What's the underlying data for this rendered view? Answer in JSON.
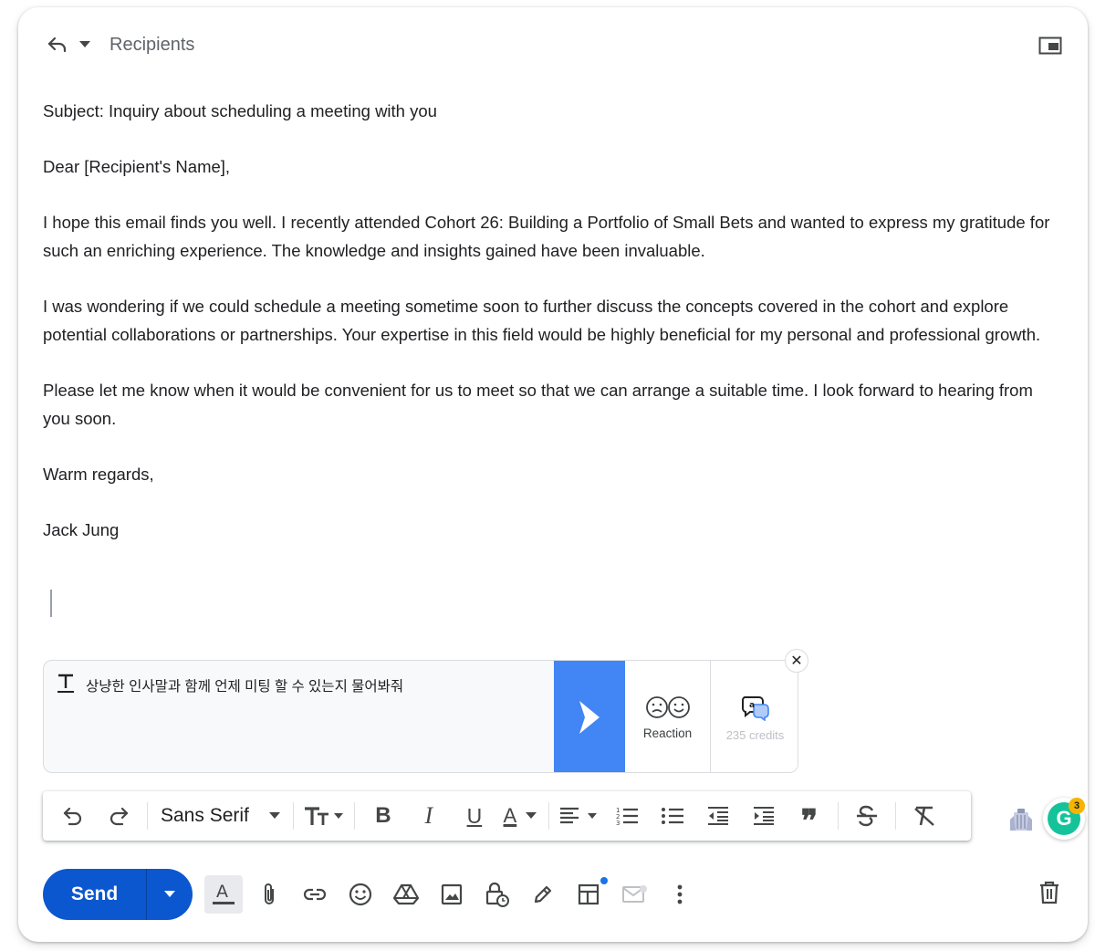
{
  "header": {
    "recipients_placeholder": "Recipients"
  },
  "email": {
    "subject_line": "Subject: Inquiry about scheduling a meeting with you",
    "greeting": "Dear [Recipient's Name],",
    "paragraph_1": "I hope this email finds you well. I recently attended Cohort 26: Building a Portfolio of Small Bets and wanted to express my gratitude for such an enriching experience. The knowledge and insights gained have been invaluable.",
    "paragraph_2": "I was wondering if we could schedule a meeting sometime soon to further discuss the concepts covered in the cohort and explore potential collaborations or partnerships. Your expertise in this field would be highly beneficial for my personal and professional growth.",
    "paragraph_3": "Please let me know when it would be convenient for us to meet so that we can arrange a suitable time. I look forward to hearing from you soon.",
    "closing": "Warm regards,",
    "signature": "Jack Jung"
  },
  "ai_panel": {
    "prompt": "상냥한 인사말과 함께 언제 미팅 할 수 있는지 물어봐줘",
    "reaction_label": "Reaction",
    "credits_label": "235 credits",
    "close_glyph": "✕",
    "accent_color": "#4285f4"
  },
  "format_toolbar": {
    "font_name": "Sans Serif",
    "bold_glyph": "B",
    "italic_glyph": "I",
    "underline_glyph": "U",
    "text_color_glyph": "A",
    "quote_glyph": "❞"
  },
  "grammarly": {
    "letter": "G",
    "badge_count": "3",
    "color": "#15c39a"
  },
  "bottom_bar": {
    "send_label": "Send",
    "send_color": "#0b57d0",
    "text_format_glyph": "A"
  }
}
